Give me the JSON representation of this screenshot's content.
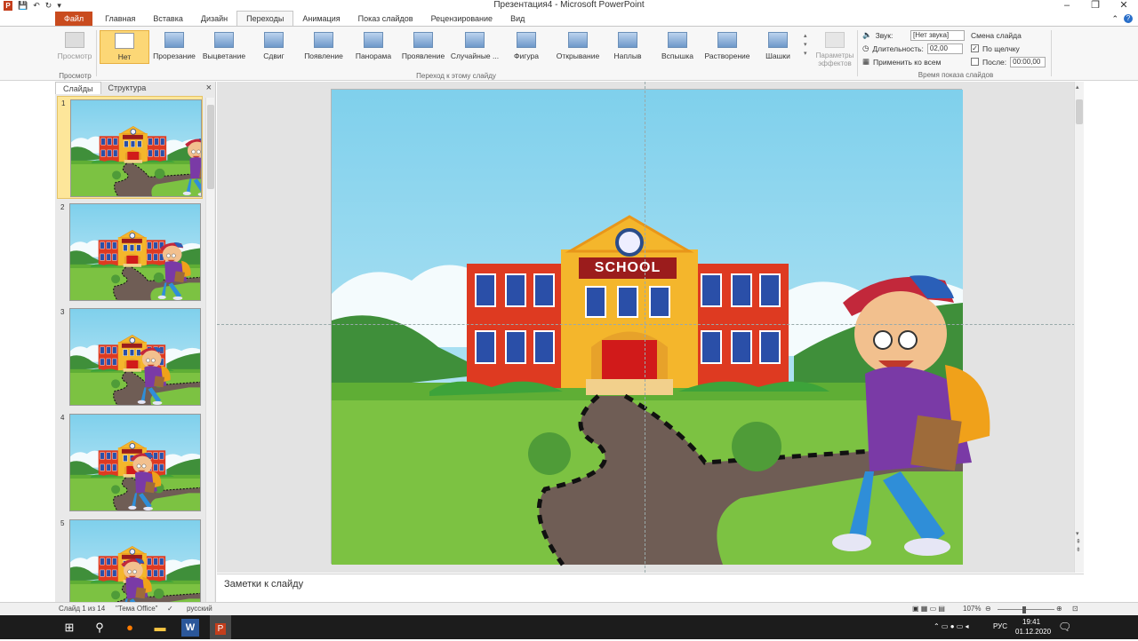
{
  "window": {
    "title": "Презентация4  -  Microsoft PowerPoint"
  },
  "tabs": [
    {
      "label": "Файл"
    },
    {
      "label": "Главная"
    },
    {
      "label": "Вставка"
    },
    {
      "label": "Дизайн"
    },
    {
      "label": "Переходы"
    },
    {
      "label": "Анимация"
    },
    {
      "label": "Показ слайдов"
    },
    {
      "label": "Рецензирование"
    },
    {
      "label": "Вид"
    }
  ],
  "ribbon": {
    "preview": {
      "label": "Просмотр",
      "group": "Просмотр"
    },
    "transitions_group": "Переход к этому слайду",
    "transitions": [
      {
        "label": "Нет"
      },
      {
        "label": "Прорезание"
      },
      {
        "label": "Выцветание"
      },
      {
        "label": "Сдвиг"
      },
      {
        "label": "Появление"
      },
      {
        "label": "Панорама"
      },
      {
        "label": "Проявление"
      },
      {
        "label": "Случайные ..."
      },
      {
        "label": "Фигура"
      },
      {
        "label": "Открывание"
      },
      {
        "label": "Наплыв"
      },
      {
        "label": "Вспышка"
      },
      {
        "label": "Растворение"
      },
      {
        "label": "Шашки"
      }
    ],
    "effect_params": "Параметры эффектов",
    "timing": {
      "sound_label": "Звук:",
      "sound_value": "[Нет звука]",
      "duration_label": "Длительность:",
      "duration_value": "02,00",
      "apply_all": "Применить ко всем",
      "advance_title": "Смена слайда",
      "on_click": "По щелчку",
      "after_label": "После:",
      "after_value": "00:00,00",
      "group": "Время показа слайдов"
    }
  },
  "pane": {
    "tab_slides": "Слайды",
    "tab_outline": "Структура",
    "close": "×",
    "slide_numbers": [
      "1",
      "2",
      "3",
      "4",
      "5"
    ]
  },
  "slide": {
    "sign_text": "SCHOOL"
  },
  "notes": {
    "placeholder": "Заметки к слайду"
  },
  "status": {
    "slide_info": "Слайд 1 из 14",
    "theme": "\"Тема Office\"",
    "language": "русский",
    "zoom": "107%"
  },
  "taskbar": {
    "lang": "РУС",
    "time": "19:41",
    "date": "01.12.2020"
  },
  "colors": {
    "accent": "#c94b1e",
    "selection": "#fcd776"
  }
}
